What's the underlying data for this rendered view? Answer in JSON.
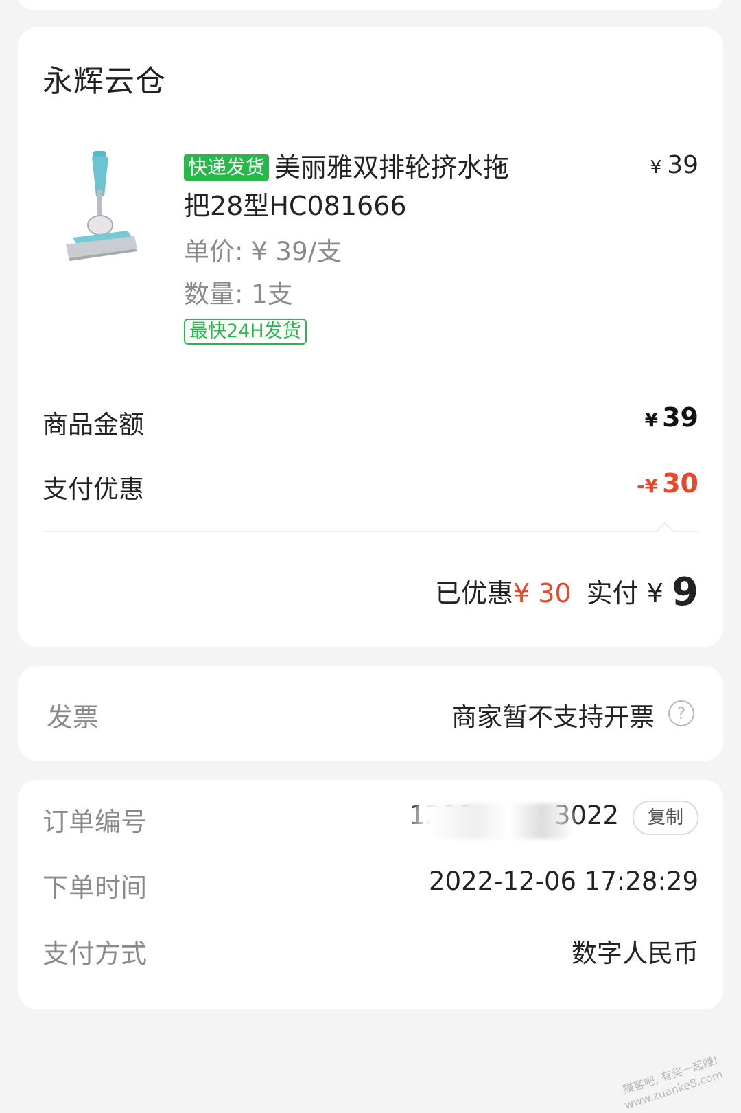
{
  "store": {
    "name": "永辉云仓",
    "product": {
      "delivery_tag": "快递发货",
      "title": "美丽雅双排轮挤水拖把28型HC081666",
      "price_symbol": "¥",
      "price": "39",
      "unit_price_label": "单价:",
      "unit_price": "¥ 39/支",
      "quantity_label": "数量:",
      "quantity": "1支",
      "shipping_tag": "最快24H发货"
    },
    "summary": {
      "goods_label": "商品金额",
      "goods_symbol": "¥",
      "goods_value": "39",
      "discount_label": "支付优惠",
      "discount_symbol": "-¥",
      "discount_value": "30"
    },
    "total": {
      "saved_label": "已优惠",
      "saved_value": "¥ 30",
      "paid_label": "实付",
      "paid_symbol": "¥",
      "paid_value": "9"
    }
  },
  "invoice": {
    "label": "发票",
    "value": "商家暂不支持开票",
    "help_icon": "?"
  },
  "order": {
    "number_label": "订单编号",
    "number_value": "1200 ···· ··· 3022",
    "copy_label": "复制",
    "time_label": "下单时间",
    "time_value": "2022-12-06 17:28:29",
    "payment_label": "支付方式",
    "payment_value": "数字人民币"
  },
  "watermark": {
    "line1": "赚客吧, 有奖一起赚!",
    "line2": "www.zuanke8.com"
  },
  "colors": {
    "green": "#27b84a",
    "red": "#e8472a",
    "background": "#f4f4f4"
  }
}
